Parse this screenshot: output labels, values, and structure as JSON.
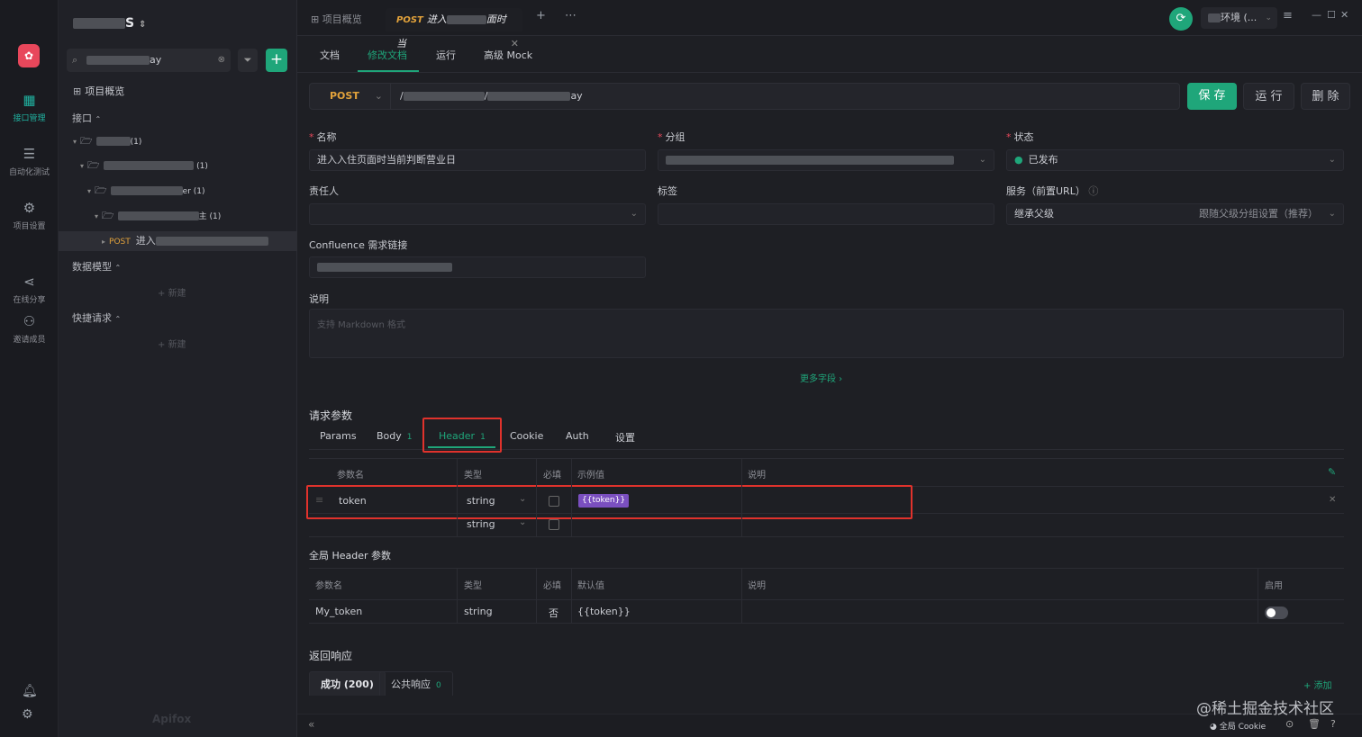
{
  "rail": {
    "items": [
      {
        "label": "接口管理",
        "icon": "api-management-icon"
      },
      {
        "label": "自动化测试",
        "icon": "automation-test-icon"
      },
      {
        "label": "项目设置",
        "icon": "project-settings-icon"
      },
      {
        "label": "在线分享",
        "icon": "share-icon"
      },
      {
        "label": "邀请成员",
        "icon": "invite-member-icon"
      }
    ]
  },
  "sidebar": {
    "project_title": "S",
    "search_value": "ay",
    "overview": "项目概览",
    "interfaces_head": "接口",
    "tree": [
      {
        "label": "(1)"
      },
      {
        "label": "(1)"
      },
      {
        "label": "er (1)"
      },
      {
        "label": "主 (1)"
      },
      {
        "method": "POST",
        "label": "进入"
      }
    ],
    "data_model_head": "数据模型",
    "quick_request_head": "快捷请求",
    "new_label": "新建",
    "brand": "Apifox"
  },
  "topbar": {
    "tabs": [
      {
        "label": "项目概览"
      },
      {
        "method": "POST",
        "label": "进入",
        "label2": "面时当"
      }
    ],
    "env_label": "环境 (..."
  },
  "main": {
    "subtabs": [
      "文档",
      "修改文档",
      "运行",
      "高级 Mock"
    ],
    "method": "POST",
    "url": "/",
    "url_tail": "ay",
    "buttons": {
      "save": "保 存",
      "run": "运 行",
      "delete": "删 除"
    },
    "fields": {
      "name_label": "名称",
      "name_value": "进入入住页面时当前判断营业日",
      "group_label": "分组",
      "status_label": "状态",
      "status_value": "已发布",
      "owner_label": "责任人",
      "tags_label": "标签",
      "service_label": "服务（前置URL）",
      "service_value": "继承父级",
      "service_hint": "跟随父级分组设置（推荐）",
      "confluence_label": "Confluence 需求链接",
      "desc_label": "说明",
      "desc_placeholder": "支持 Markdown 格式",
      "more_fields": "更多字段 ›"
    },
    "request_params": {
      "title": "请求参数",
      "tabs": [
        {
          "label": "Params"
        },
        {
          "label": "Body",
          "count": "1"
        },
        {
          "label": "Header",
          "count": "1"
        },
        {
          "label": "Cookie"
        },
        {
          "label": "Auth"
        },
        {
          "label": "设置"
        }
      ],
      "columns": [
        "参数名",
        "类型",
        "必填",
        "示例值",
        "说明"
      ],
      "rows": [
        {
          "name": "token",
          "type": "string",
          "example": "{{token}}"
        },
        {
          "name": "",
          "type": "string",
          "example": ""
        }
      ]
    },
    "global_header": {
      "title": "全局 Header 参数",
      "columns": [
        "参数名",
        "类型",
        "必填",
        "默认值",
        "说明",
        "启用"
      ],
      "rows": [
        {
          "name": "My_token",
          "type": "string",
          "required": "否",
          "default": "{{token}}"
        }
      ]
    },
    "response": {
      "title": "返回响应",
      "tabs": [
        {
          "label": "成功 (200)"
        },
        {
          "label": "公共响应",
          "count": "0"
        }
      ],
      "add_label": "+ 添加"
    }
  },
  "statusbar": {
    "cookie_label": "全局 Cookie"
  },
  "watermark": "@稀土掘金技术社区"
}
